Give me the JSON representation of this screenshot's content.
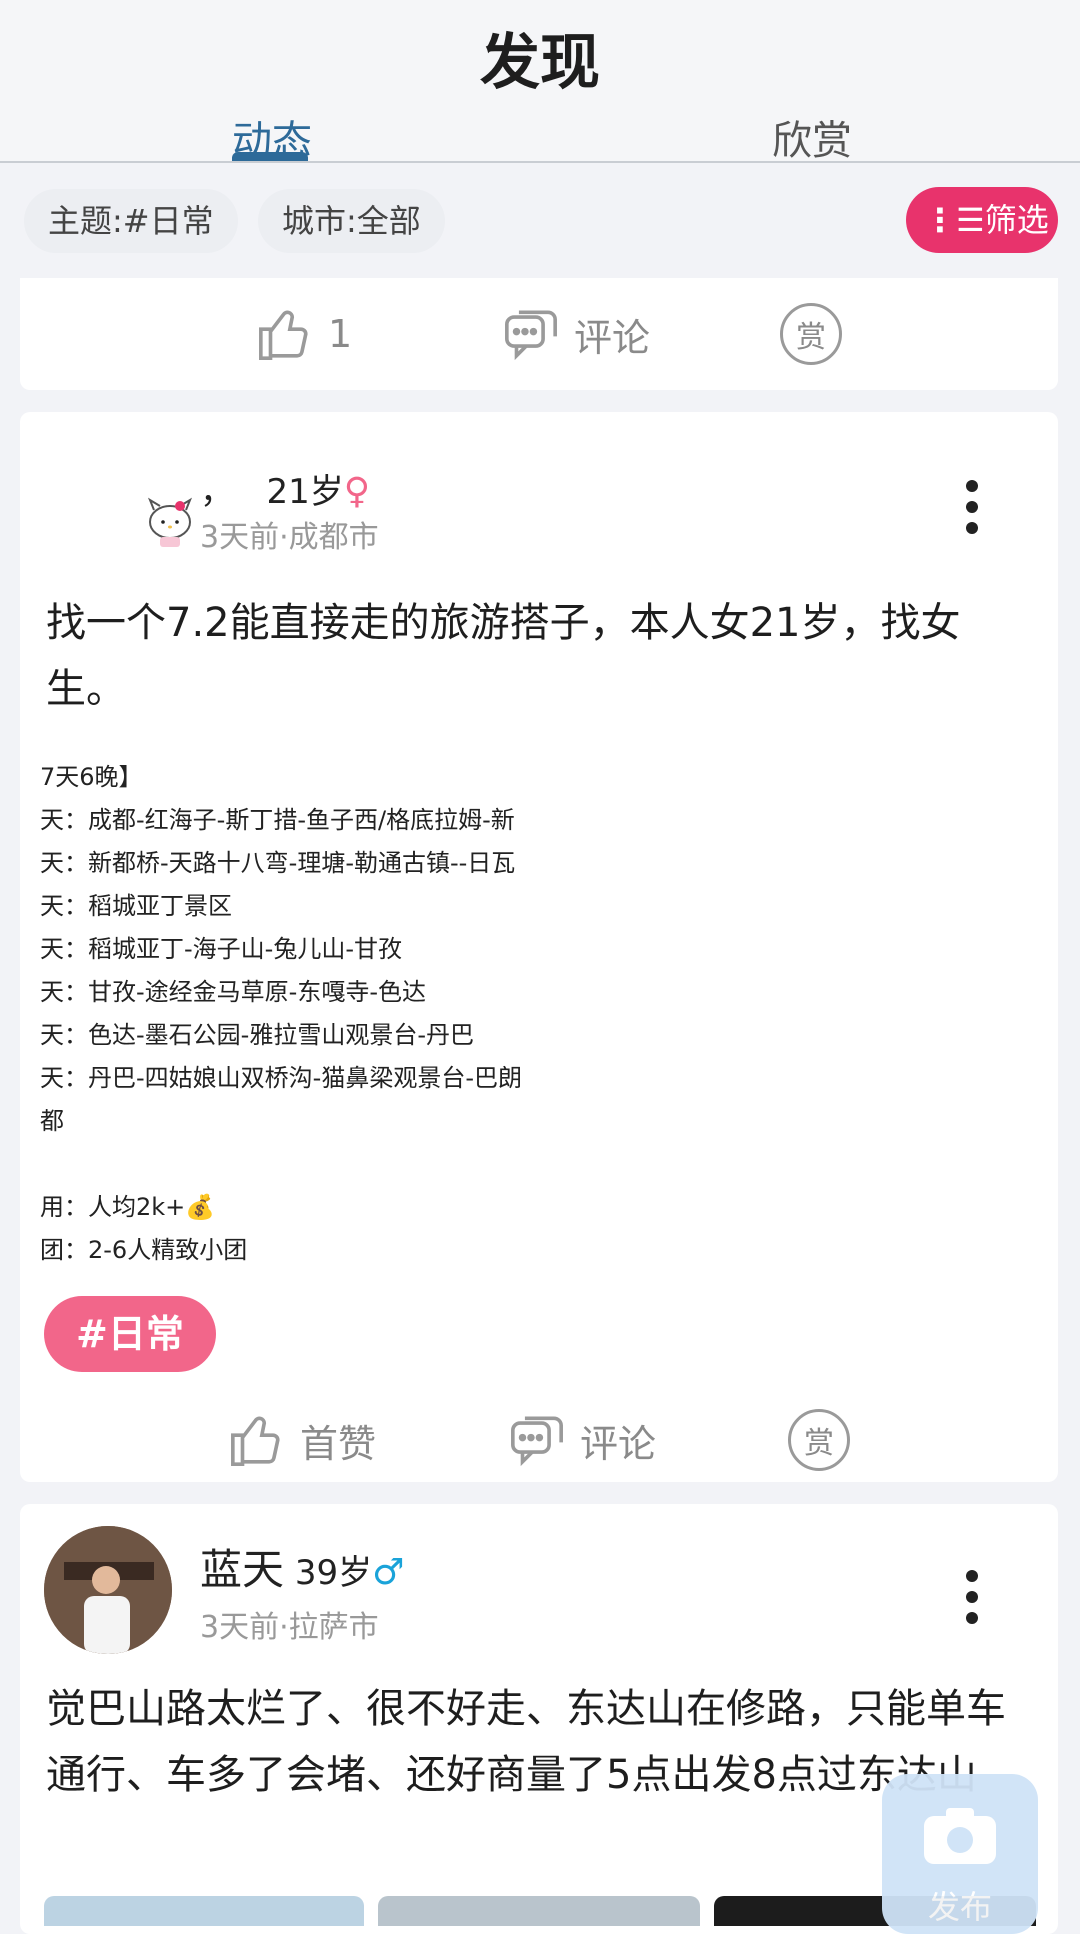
{
  "header": {
    "title": "发现",
    "tabs": [
      {
        "label": "动态",
        "active": true
      },
      {
        "label": "欣赏",
        "active": false
      }
    ]
  },
  "filters": {
    "theme_chip": "主题:#日常",
    "city_chip": "城市:全部",
    "filter_button": "筛选",
    "filter_button_color": "#e8336c"
  },
  "prev_post": {
    "like_count": "1",
    "comment_label": "评论",
    "reward_label": "赏"
  },
  "post1": {
    "username": "，",
    "age": "21岁",
    "gender_icon": "female-icon",
    "meta": "3天前·成都市",
    "text": "找一个7.2能直接走的旅游搭子，本人女21岁，找女生。",
    "itinerary": [
      "7天6晚】",
      "天：成都-红海子-斯丁措-鱼子西/格底拉姆-新",
      "天：新都桥-天路十八弯-理塘-勒通古镇--日瓦",
      "天：稻城亚丁景区",
      "天：稻城亚丁-海子山-兔儿山-甘孜",
      "天：甘孜-途经金马草原-东嘎寺-色达",
      "天：色达-墨石公园-雅拉雪山观景台-丹巴",
      "天：丹巴-四姑娘山双桥沟-猫鼻梁观景台-巴朗",
      "都",
      "",
      "用：人均2k+💰",
      "团：2-6人精致小团"
    ],
    "tag": "#日常",
    "like_label": "首赞",
    "comment_label": "评论",
    "reward_label": "赏"
  },
  "post2": {
    "username": "蓝天",
    "age": "39岁",
    "gender_icon": "male-icon",
    "meta": "3天前·拉萨市",
    "text": "觉巴山路太烂了、很不好走、东达山在修路，只能单车通行、车多了会堵、还好商量了5点出发8点过东达山"
  },
  "fab": {
    "label": "发布"
  }
}
